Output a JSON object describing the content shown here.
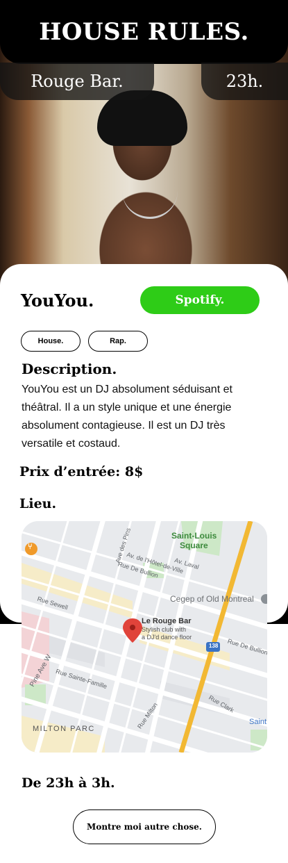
{
  "header": {
    "title": "HOUSE RULES."
  },
  "venue": {
    "name": "Rouge Bar.",
    "time": "23h."
  },
  "artist": {
    "name": "YouYou.",
    "spotify_label": "Spotify.",
    "tags": [
      "House.",
      "Rap."
    ]
  },
  "description": {
    "title": "Description.",
    "text": "YouYou est un DJ absolument séduisant et théâtral. Il a un style unique et une énergie absolument contagieuse. Il est un DJ très versatile et costaud."
  },
  "price": {
    "label": "Prix d’entrée: 8$"
  },
  "location": {
    "title": "Lieu.",
    "map": {
      "place_name": "Le Rouge Bar",
      "place_desc_line1": "Stylish club with",
      "place_desc_line2": "a DJ'd dance floor",
      "labels": {
        "saint_louis_1": "Saint-Louis",
        "saint_louis_2": "Square",
        "cegep": "Cegep of Old Montreal",
        "milton_parc": "MILTON PARC",
        "ave_des_pins": "Ave des Pins",
        "ave_hotel_de_ville": "Av. de l'Hôtel-de-Ville",
        "rue_de_bullion_1": "Rue De Bullion",
        "rue_de_bullion_2": "Rue De Bullion",
        "av_laval": "Av. Laval",
        "rue_sewell": "Rue Sewell",
        "pine_ave": "Pine Ave W",
        "rue_sainte_famille": "Rue Sainte-Famille",
        "rue_milton": "Rue Milton",
        "rue_clark": "Rue Clark",
        "route_138": "138",
        "saint": "Saint"
      }
    }
  },
  "schedule": {
    "hours": "De 23h à 3h."
  },
  "actions": {
    "more_label": "Montre moi autre chose."
  }
}
